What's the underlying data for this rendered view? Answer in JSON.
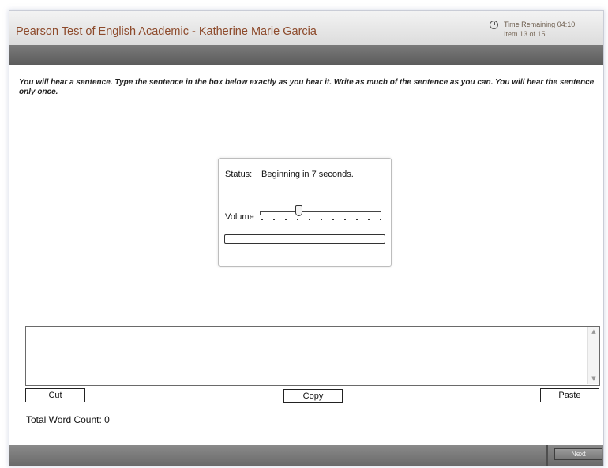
{
  "header": {
    "app_title": "Pearson Test of English Academic - Katherine Marie Garcia",
    "time_remaining": "Time Remaining 04:10",
    "item_counter": "Item 13 of 15"
  },
  "instructions": "You will hear a sentence. Type the sentence in the box below exactly as you hear it. Write as much of the sentence as you can. You will hear the sentence only once.",
  "audio_player": {
    "status_label": "Status:",
    "status_text": "Beginning in 7 seconds.",
    "volume_label": "Volume",
    "volume_level": 0.31,
    "playback_progress": 0
  },
  "answer": {
    "value": ""
  },
  "toolbar": {
    "cut_label": "Cut",
    "copy_label": "Copy",
    "paste_label": "Paste"
  },
  "word_count": "Total Word Count: 0",
  "footer": {
    "next_label": "Next"
  },
  "icons": {
    "clock": "clock-icon",
    "scroll_up": "scroll-up-arrow-icon",
    "scroll_down": "scroll-down-arrow-icon"
  }
}
